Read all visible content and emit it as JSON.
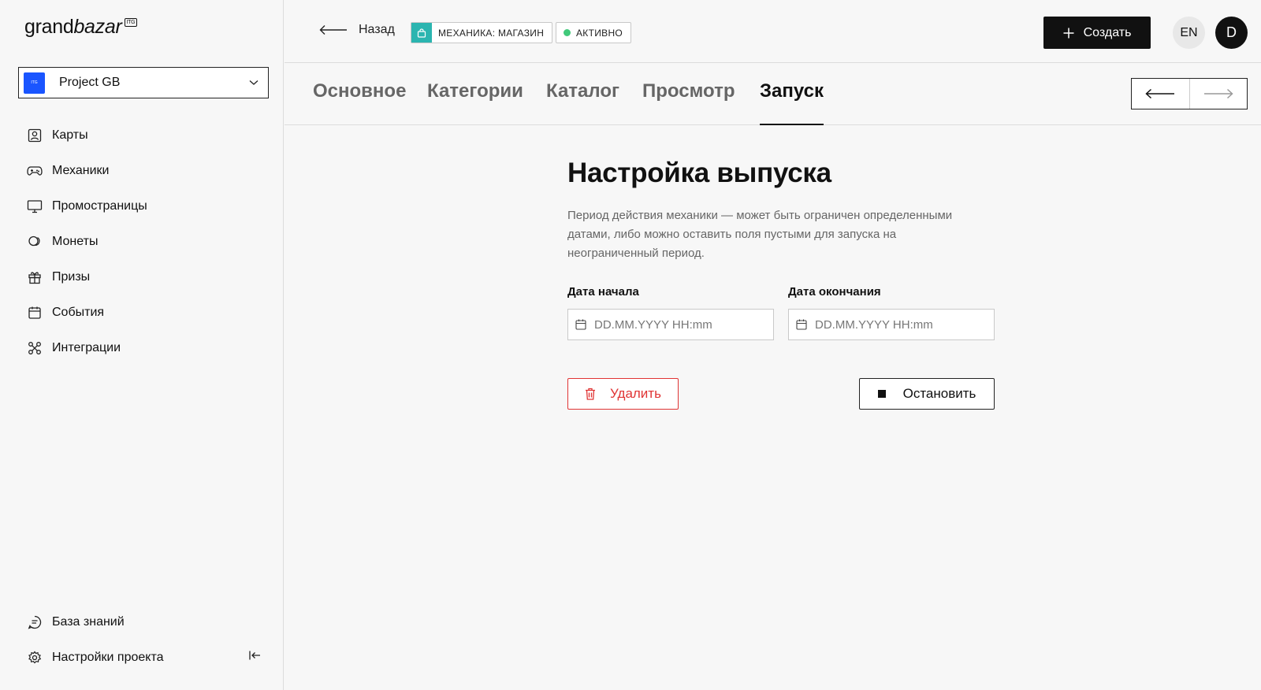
{
  "brand": {
    "name_part1": "grand",
    "name_part2": "bazar",
    "badge": "ITG"
  },
  "project": {
    "name": "Project GB",
    "icon_text": "ITG"
  },
  "sidebar": {
    "items": [
      {
        "label": "Карты",
        "icon": "id-card-icon"
      },
      {
        "label": "Механики",
        "icon": "gamepad-icon"
      },
      {
        "label": "Промостраницы",
        "icon": "monitor-icon"
      },
      {
        "label": "Монеты",
        "icon": "coins-icon"
      },
      {
        "label": "Призы",
        "icon": "gift-icon"
      },
      {
        "label": "События",
        "icon": "calendar-icon"
      },
      {
        "label": "Интеграции",
        "icon": "integrations-icon"
      }
    ],
    "bottom": [
      {
        "label": "База знаний",
        "icon": "chat-doc-icon"
      },
      {
        "label": "Настройки проекта",
        "icon": "settings-icon"
      }
    ]
  },
  "header": {
    "back_label": "Назад",
    "mechanic_badge": "МЕХАНИКА: МАГАЗИН",
    "status_badge": "АКТИВНО",
    "create_label": "Создать",
    "lang": "EN",
    "avatar": "D"
  },
  "tabs": [
    "Основное",
    "Категории",
    "Каталог",
    "Просмотр",
    "Запуск"
  ],
  "main": {
    "title": "Настройка выпуска",
    "description": "Период действия механики — может быть ограничен определенными датами, либо можно оставить поля пустыми для запуска на неограниченный период.",
    "start_label": "Дата начала",
    "end_label": "Дата окончания",
    "date_placeholder": "DD.MM.YYYY HH:mm",
    "delete_label": "Удалить",
    "stop_label": "Остановить"
  },
  "colors": {
    "accent_blue": "#1a55ff",
    "teal": "#2bb5b0",
    "danger": "#e03434",
    "active_dot": "#41c97a"
  }
}
